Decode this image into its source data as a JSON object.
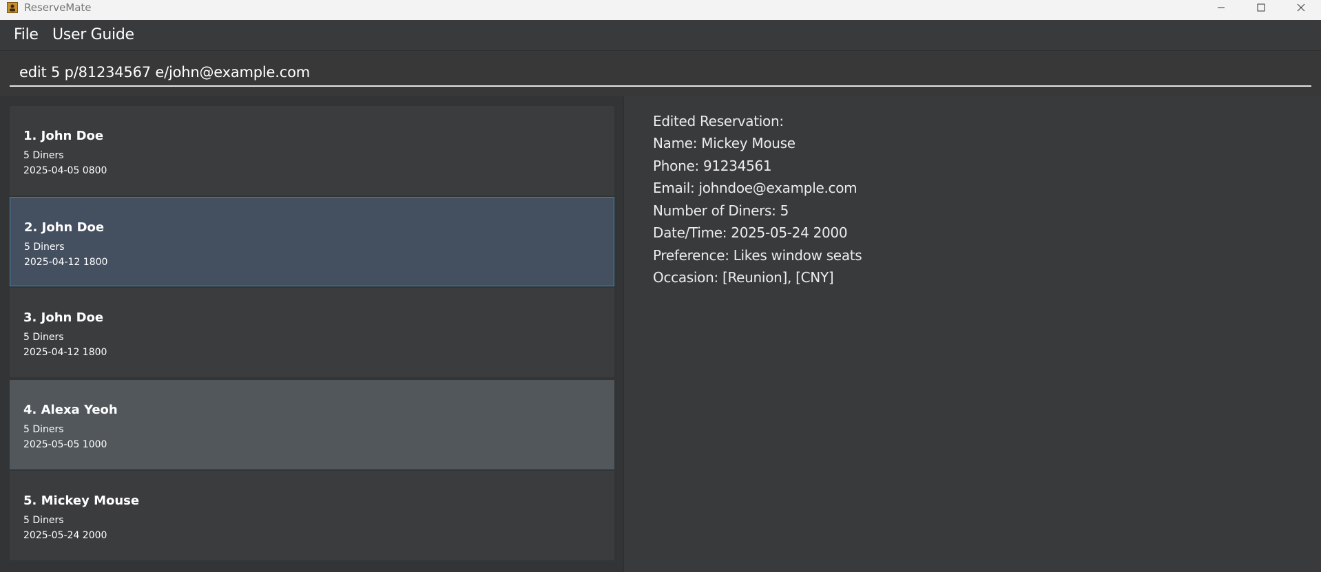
{
  "window": {
    "title": "ReserveMate",
    "icon": "app-icon"
  },
  "menu": {
    "file": "File",
    "user_guide": "User Guide"
  },
  "command": {
    "value": "edit 5 p/81234567 e/john@example.com"
  },
  "reservations": [
    {
      "title": "1. John Doe",
      "diners": "5 Diners",
      "datetime": "2025-04-05 0800"
    },
    {
      "title": "2. John Doe",
      "diners": "5 Diners",
      "datetime": "2025-04-12 1800"
    },
    {
      "title": "3. John Doe",
      "diners": "5 Diners",
      "datetime": "2025-04-12 1800"
    },
    {
      "title": "4. Alexa Yeoh",
      "diners": "5 Diners",
      "datetime": "2025-05-05 1000"
    },
    {
      "title": "5. Mickey Mouse",
      "diners": "5 Diners",
      "datetime": "2025-05-24 2000"
    }
  ],
  "result": {
    "lines": [
      "Edited Reservation:",
      "Name: Mickey Mouse",
      "Phone: 91234561",
      "Email: johndoe@example.com",
      "Number of Diners: 5",
      "Date/Time: 2025-05-24 2000",
      "Preference: Likes window seats",
      "Occasion: [Reunion], [CNY]"
    ]
  },
  "colors": {
    "background": "#3a3b3d",
    "selected_card": "#444f60",
    "selected_border": "#3d8aa8",
    "hovered_card": "#51575b"
  }
}
